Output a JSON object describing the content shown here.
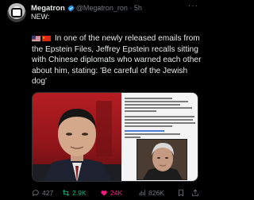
{
  "post": {
    "author_name": "Megatron",
    "handle_time": "@Megatron_ron · 5h",
    "label": "NEW:",
    "text": "In one of the newly released emails from the Epstein Files, Jeffrey Epstein recalls sitting with Chinese diplomats who warned each other about him, stating: 'Be careful of the Jewish dog'",
    "icons": [
      "us-flag-icon",
      "china-flag-icon",
      "verified-badge-icon",
      "more-options-icon"
    ]
  },
  "actions": {
    "replies": "427",
    "reposts": "2.9K",
    "likes": "24K",
    "views": "826K",
    "colors": {
      "muted": "#71767b",
      "repost": "#00ba7c",
      "like": "#f91880",
      "verified": "#1d9bf0"
    }
  }
}
